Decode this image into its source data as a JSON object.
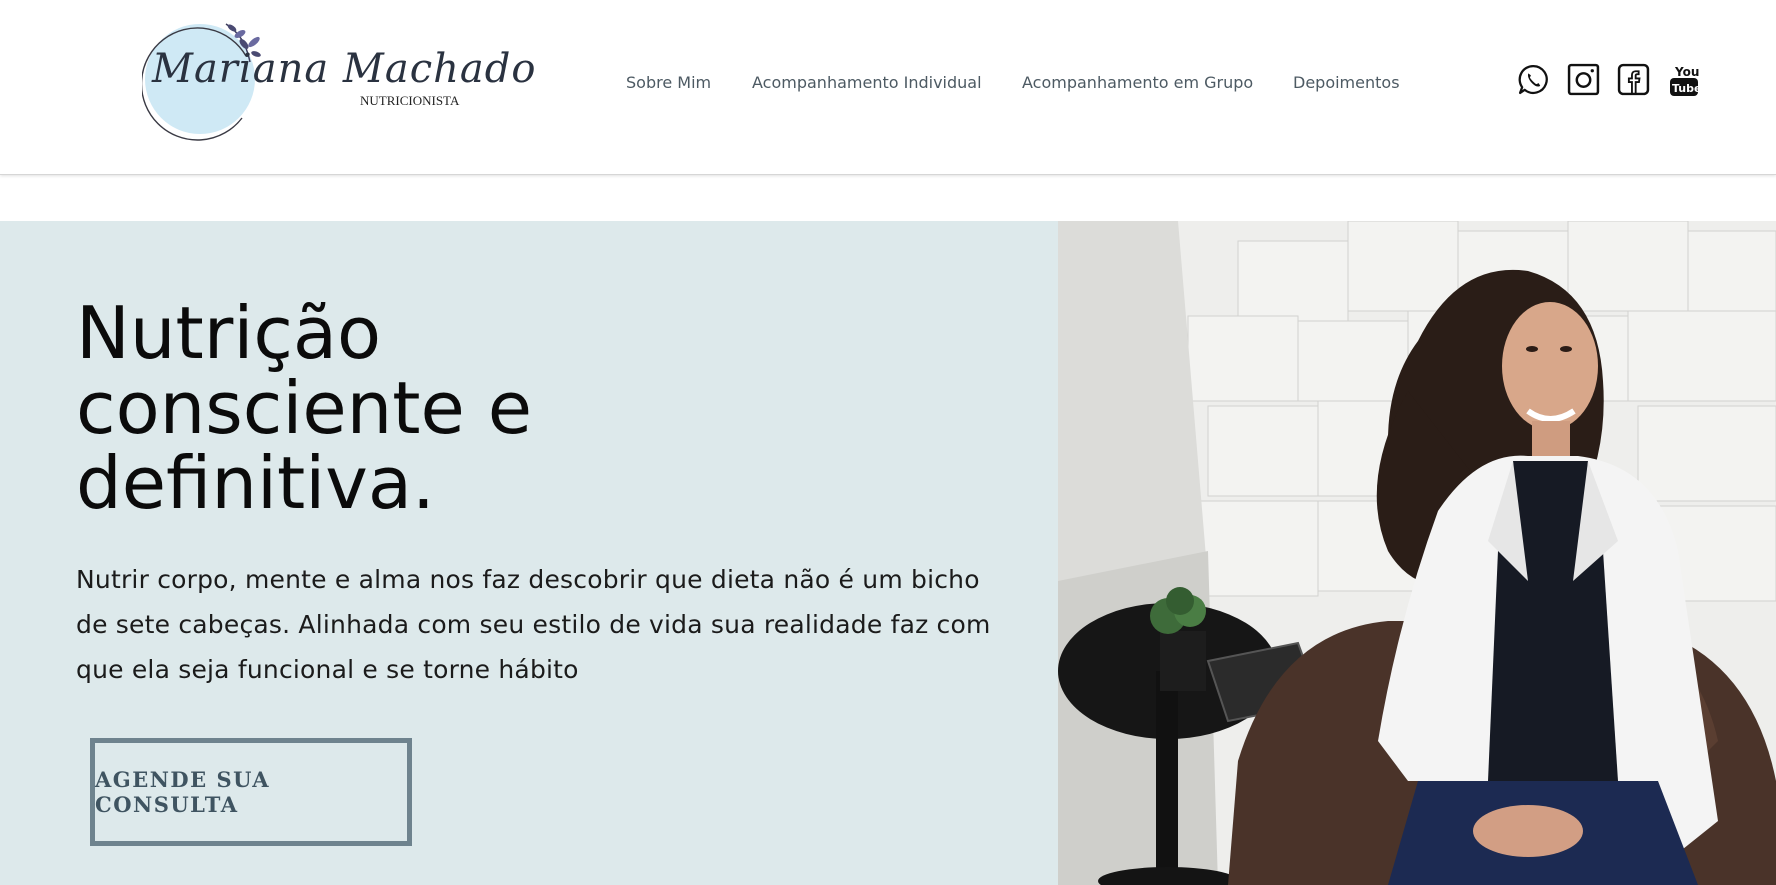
{
  "brand": {
    "name": "Mariana Machado",
    "subtitle": "NUTRICIONISTA"
  },
  "nav": {
    "items": [
      {
        "label": "Sobre Mim"
      },
      {
        "label": "Acompanhamento Individual"
      },
      {
        "label": "Acompanhamento em Grupo"
      },
      {
        "label": "Depoimentos"
      }
    ]
  },
  "social": {
    "icons": [
      "whatsapp-icon",
      "instagram-icon",
      "facebook-icon",
      "youtube-icon"
    ],
    "youtube_text_top": "You",
    "youtube_text_bottom": "Tube"
  },
  "hero": {
    "title_line1": "Nutrição",
    "title_line2": "consciente e",
    "title_line3": "definitiva.",
    "text": "Nutrir corpo, mente e alma nos faz descobrir que dieta não é um bicho de sete cabeças. Alinhada com seu estilo de vida sua realidade faz com que ela seja funcional e se torne hábito",
    "cta_label": "AGENDE SUA CONSULTA",
    "background_color": "#dde9eb",
    "cta_border_color": "#6e838e"
  }
}
